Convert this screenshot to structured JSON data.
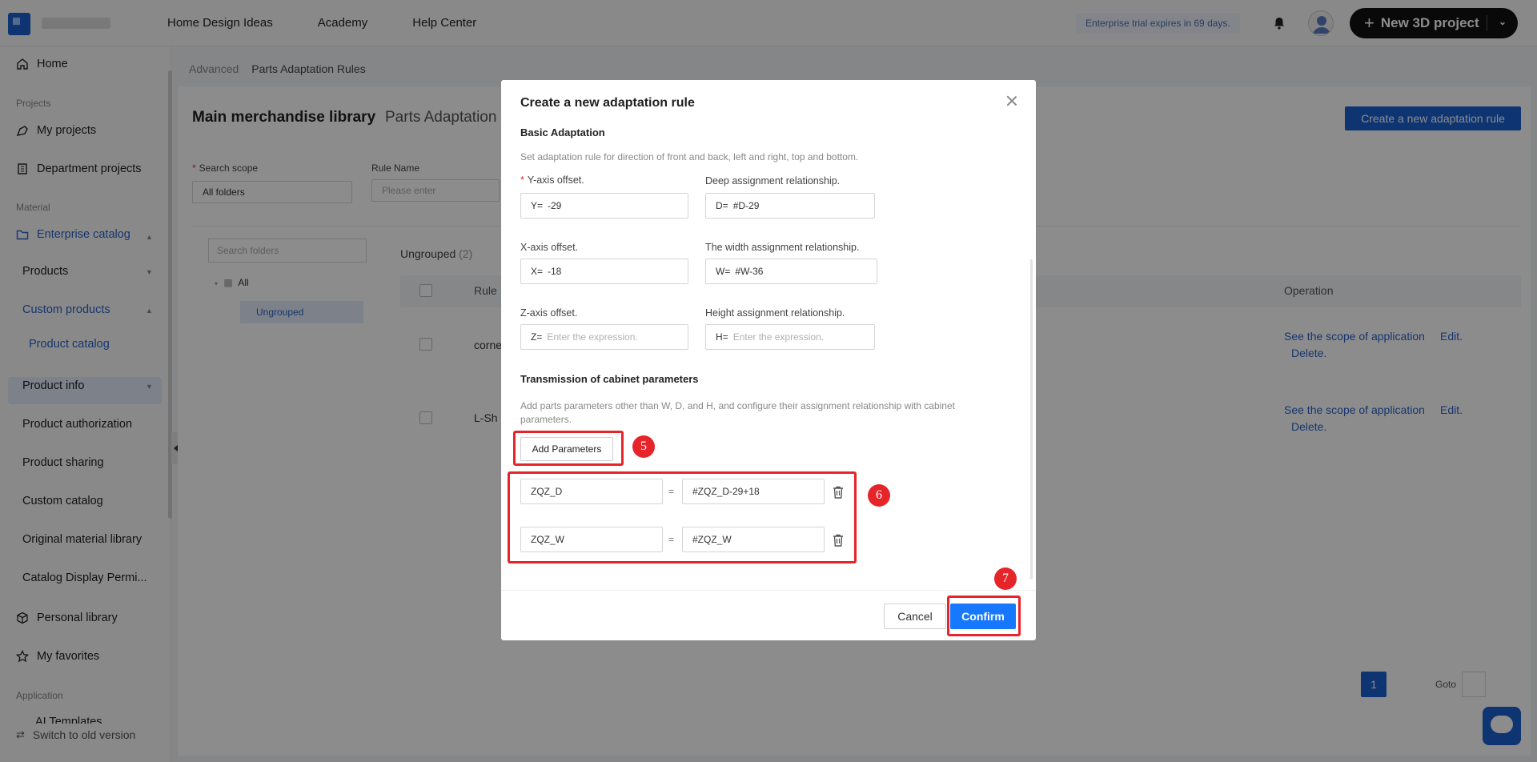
{
  "topbar": {
    "nav": [
      "Home Design Ideas",
      "Academy",
      "Help Center"
    ],
    "trial_notice": "Enterprise trial expires in 69 days.",
    "new_project_label": "New 3D project"
  },
  "sidebar": {
    "home": "Home",
    "section_projects": "Projects",
    "my_projects": "My projects",
    "department_projects": "Department projects",
    "section_material": "Material",
    "enterprise_catalog": "Enterprise catalog",
    "products": "Products",
    "custom_products": "Custom products",
    "product_catalog": "Product catalog",
    "product_info": "Product info",
    "product_authorization": "Product authorization",
    "product_sharing": "Product sharing",
    "custom_catalog": "Custom catalog",
    "original_material_library": "Original material library",
    "catalog_display": "Catalog Display Permi...",
    "personal_library": "Personal library",
    "my_favorites": "My favorites",
    "section_application": "Application",
    "ai_templates": "AI Templates",
    "switch_old": "Switch to old version"
  },
  "main": {
    "breadcrumb_root": "Advanced",
    "breadcrumb_current": "Parts Adaptation Rules",
    "tab_main": "Main merchandise library",
    "tab_sub": "Parts Adaptation",
    "create_button": "Create a new adaptation rule",
    "search_scope_label": "Search scope",
    "search_scope_value": "All folders",
    "rule_name_label": "Rule Name",
    "rule_name_placeholder": "Please enter",
    "folder_search_placeholder": "Search folders",
    "tree_all": "All",
    "tree_ungrouped": "Ungrouped",
    "group_title": "Ungrouped",
    "group_count": "(2)",
    "col_rule": "Rule",
    "col_operation": "Operation",
    "rows": [
      {
        "name": "corne",
        "scope": "See the scope of application",
        "edit": "Edit.",
        "delete": "Delete."
      },
      {
        "name": "L-Sh",
        "scope": "See the scope of application",
        "edit": "Edit.",
        "delete": "Delete."
      }
    ],
    "page": "1",
    "goto": "Goto"
  },
  "modal": {
    "title": "Create a new adaptation rule",
    "basic_title": "Basic Adaptation",
    "basic_desc": "Set adaptation rule for direction of front and back, left and right, top and bottom.",
    "y_label": "Y-axis offset.",
    "y_prefix": "Y=",
    "y_value": "-29",
    "d_label": "Deep assignment relationship.",
    "d_prefix": "D=",
    "d_value": "#D-29",
    "x_label": "X-axis offset.",
    "x_prefix": "X=",
    "x_value": "-18",
    "w_label": "The width assignment relationship.",
    "w_prefix": "W=",
    "w_value": "#W-36",
    "z_label": "Z-axis offset.",
    "z_prefix": "Z=",
    "z_placeholder": "Enter the expression.",
    "h_label": "Height assignment relationship.",
    "h_prefix": "H=",
    "h_placeholder": "Enter the expression.",
    "trans_title": "Transmission of cabinet parameters",
    "trans_desc": "Add parts parameters other than W, D, and H, and configure their assignment relationship with cabinet parameters.",
    "add_params": "Add Parameters",
    "params": [
      {
        "name": "ZQZ_D",
        "eq": "=",
        "value": "#ZQZ_D-29+18"
      },
      {
        "name": "ZQZ_W",
        "eq": "=",
        "value": "#ZQZ_W"
      }
    ],
    "cancel": "Cancel",
    "confirm": "Confirm"
  },
  "callouts": [
    "5",
    "6",
    "7"
  ],
  "colors": {
    "accent": "#1677ff",
    "highlight": "#e5252a",
    "brand": "#1a5fd0"
  }
}
